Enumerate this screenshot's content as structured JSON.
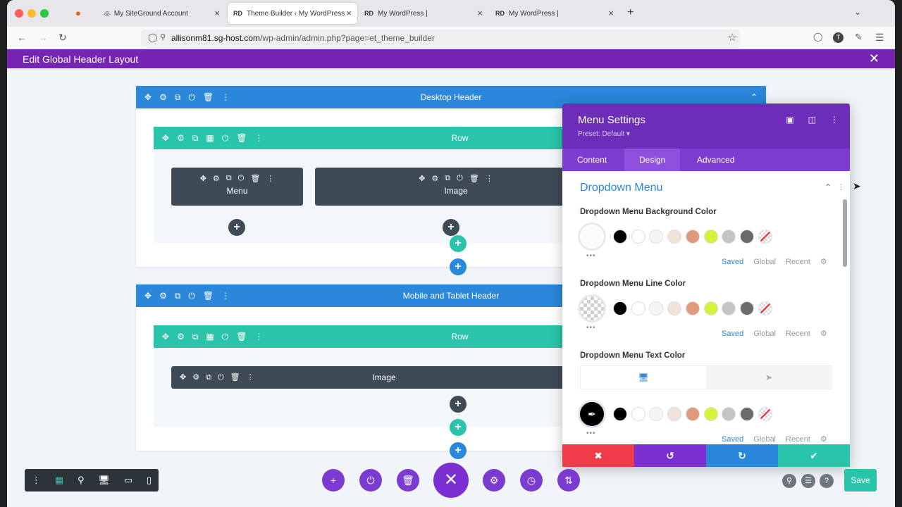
{
  "browser": {
    "tabs": [
      {
        "favicon": "◎",
        "title": "My SiteGround Account"
      },
      {
        "favicon": "RD",
        "title": "Theme Builder ‹ My WordPress"
      },
      {
        "favicon": "RD",
        "title": "My WordPress |"
      },
      {
        "favicon": "RD",
        "title": "My WordPress |"
      }
    ],
    "url_host": "allisonm81.sg-host.com",
    "url_path": "/wp-admin/admin.php?page=et_theme_builder",
    "new_tab": "+",
    "profile_initial": "T"
  },
  "editbar": {
    "title": "Edit Global Header Layout",
    "close": "✕"
  },
  "builder": {
    "desktop_section": "Desktop Header",
    "desktop_row": "Row",
    "menu_module": "Menu",
    "image_module": "Image",
    "mobile_section": "Mobile and Tablet Header",
    "mobile_row": "Row",
    "mobile_image_module": "Image",
    "add": "+"
  },
  "panel": {
    "title": "Menu Settings",
    "preset": "Preset: Default ▾",
    "tabs": [
      "Content",
      "Design",
      "Advanced"
    ],
    "group_title": "Dropdown Menu",
    "fields": [
      {
        "label": "Dropdown Menu Background Color"
      },
      {
        "label": "Dropdown Menu Line Color"
      },
      {
        "label": "Dropdown Menu Text Color"
      }
    ],
    "saved_labels": [
      "Saved",
      "Global",
      "Recent"
    ],
    "swatch_colors": [
      "#000000",
      "#ffffff",
      "#f7f5ef",
      "#efe3da",
      "#e29a7c",
      "#d7f23b",
      "#c4c4c4",
      "#6b6b6b"
    ],
    "footer_colors": [
      "#ef3b4a",
      "#7b2fd0",
      "#2b87da",
      "#29c4a9"
    ]
  },
  "bottombar": {
    "save": "Save"
  },
  "colors": {
    "purple_header": "#7624b3",
    "section_blue": "#2b87da",
    "row_green": "#29c4a9",
    "module_dark": "#3e4a55"
  }
}
